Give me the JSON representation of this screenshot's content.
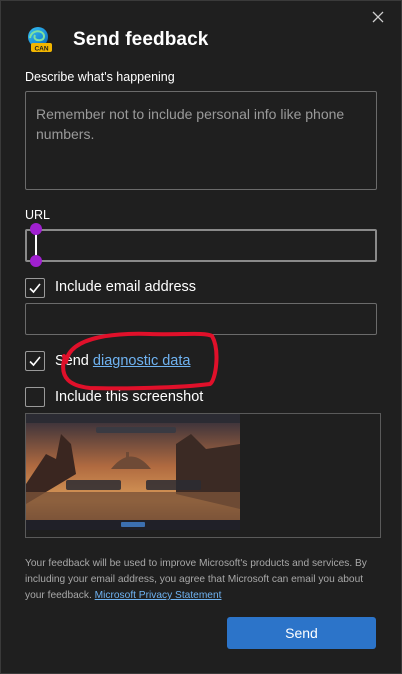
{
  "dialog": {
    "title": "Send feedback",
    "logo_badge": "CAN",
    "close_icon": "close-icon"
  },
  "describe": {
    "label": "Describe what's happening",
    "placeholder": "Remember not to include personal info like phone numbers."
  },
  "url": {
    "label": "URL",
    "value": ""
  },
  "email": {
    "checkbox_label": "Include email address",
    "checked": true,
    "value": ""
  },
  "diagnostic": {
    "prefix": "Send ",
    "link_text": "diagnostic data",
    "checked": true
  },
  "screenshot": {
    "checkbox_label": "Include this screenshot",
    "checked": false
  },
  "footer": {
    "text": "Your feedback will be used to improve Microsoft's products and services. By including your email address, you agree that Microsoft can email you about your feedback. ",
    "link_text": "Microsoft Privacy Statement"
  },
  "actions": {
    "send_label": "Send"
  },
  "colors": {
    "background": "#1f1f1f",
    "accent": "#2c74c9",
    "link": "#6fb3f2",
    "annotation": "#e0102a",
    "cursor_handle": "#a020d0"
  }
}
